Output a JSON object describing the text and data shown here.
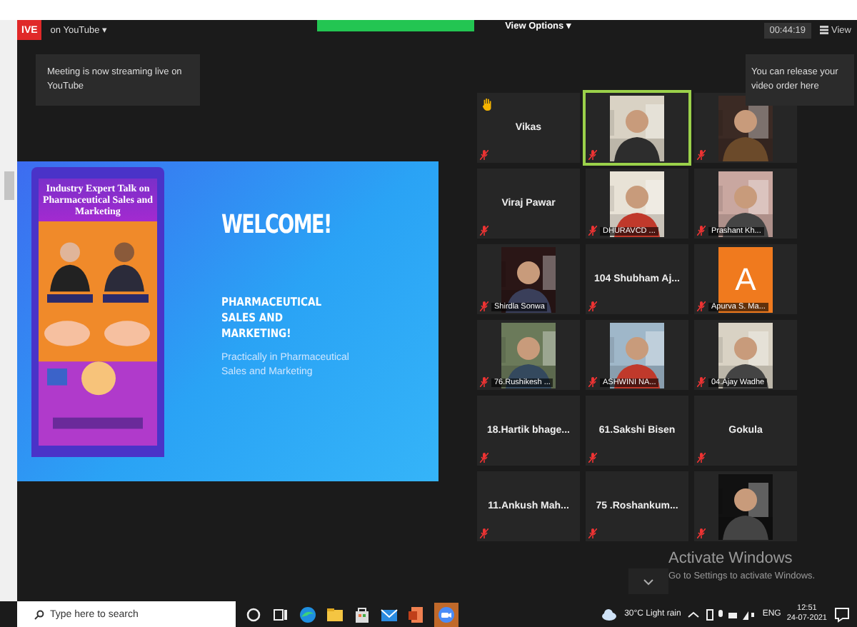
{
  "top_bar": {
    "live_badge": "IVE",
    "stream_menu": "on YouTube ▾",
    "view_options": "View Options ▾",
    "timer": "00:44:19",
    "view_button": "View"
  },
  "tooltips": {
    "streaming": "Meeting is now streaming live on YouTube",
    "video_order": "You can release your video order here"
  },
  "slide": {
    "poster_title": "Industry Expert Talk on Pharmaceutical Sales and Marketing",
    "heading": "WELCOME!",
    "subheading": "PHARMACEUTICAL SALES AND MARKETING!",
    "body": "Practically in Pharmaceutical Sales and Marketing"
  },
  "participants": [
    {
      "kind": "name",
      "name": "Vikas",
      "hand_raised": true,
      "speaking": false
    },
    {
      "kind": "video",
      "hand_raised": false,
      "speaking": true
    },
    {
      "kind": "video",
      "hand_raised": false,
      "speaking": false
    },
    {
      "kind": "name",
      "name": "Viraj Pawar",
      "hand_raised": false,
      "speaking": false
    },
    {
      "kind": "video",
      "name": "DHURAVCD ...",
      "hand_raised": false,
      "speaking": false
    },
    {
      "kind": "video",
      "name": "Prashant Kh...",
      "hand_raised": false,
      "speaking": false
    },
    {
      "kind": "video",
      "name": "Shirdla Sonwa",
      "hand_raised": false,
      "speaking": false
    },
    {
      "kind": "name",
      "name": "104 Shubham Aj...",
      "hand_raised": false,
      "speaking": false
    },
    {
      "kind": "avatar",
      "initial": "A",
      "name": "Apurva S. Ma...",
      "hand_raised": false,
      "speaking": false
    },
    {
      "kind": "video",
      "name": "76.Rushikesh ...",
      "hand_raised": false,
      "speaking": false
    },
    {
      "kind": "video",
      "name": "ASHWINI NA...",
      "hand_raised": false,
      "speaking": false
    },
    {
      "kind": "video",
      "name": "04.Ajay Wadhe",
      "hand_raised": false,
      "speaking": false
    },
    {
      "kind": "name",
      "name": "18.Hartik  bhage...",
      "hand_raised": false,
      "speaking": false
    },
    {
      "kind": "name",
      "name": "61.Sakshi Bisen",
      "hand_raised": false,
      "speaking": false
    },
    {
      "kind": "name",
      "name": "Gokula",
      "hand_raised": false,
      "speaking": false
    },
    {
      "kind": "name",
      "name": "11.Ankush  Mah...",
      "hand_raised": false,
      "speaking": false
    },
    {
      "kind": "name",
      "name": "75 .Roshankum...",
      "hand_raised": false,
      "speaking": false
    },
    {
      "kind": "video",
      "hand_raised": false,
      "speaking": false
    }
  ],
  "activation_notice": {
    "title": "Activate Windows",
    "hint": "Go to Settings to activate Windows."
  },
  "taskbar": {
    "search_placeholder": "Type here to search",
    "weather": "30°C  Light rain",
    "language": "ENG",
    "time": "12:51",
    "date": "24-07-2021"
  }
}
